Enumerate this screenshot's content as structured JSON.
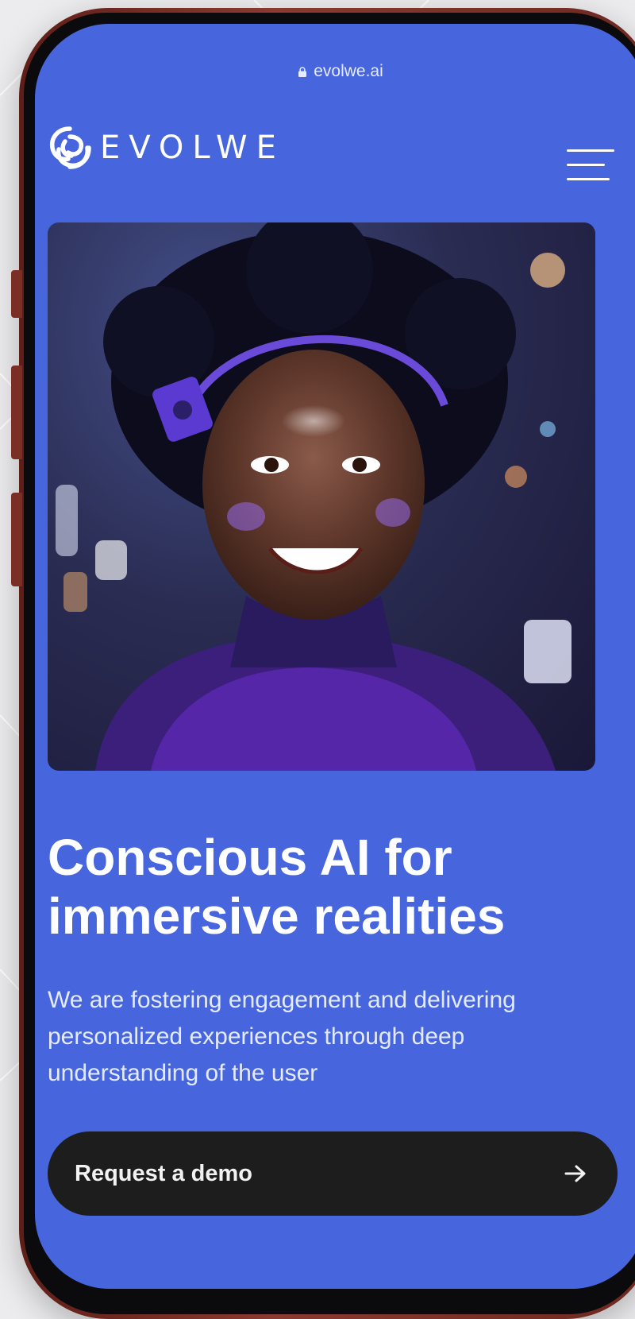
{
  "browser": {
    "url": "evolwe.ai",
    "lock_icon": "lock-icon"
  },
  "header": {
    "logo_text": "EVOLWE",
    "logo_icon": "swirl-logo-icon",
    "menu_icon": "hamburger-menu-icon"
  },
  "hero": {
    "image_subject": "hero-illustration"
  },
  "content": {
    "headline": "Conscious AI for immersive realities",
    "subtext": "We are fostering engagement and delivering personalized experiences through deep understanding of the user"
  },
  "cta": {
    "label": "Request a demo",
    "icon": "arrow-right-icon"
  },
  "colors": {
    "screen_bg": "#4766dd",
    "cta_bg": "#1d1d1d",
    "phone_frame": "#7a2e24",
    "text": "#ffffff"
  }
}
